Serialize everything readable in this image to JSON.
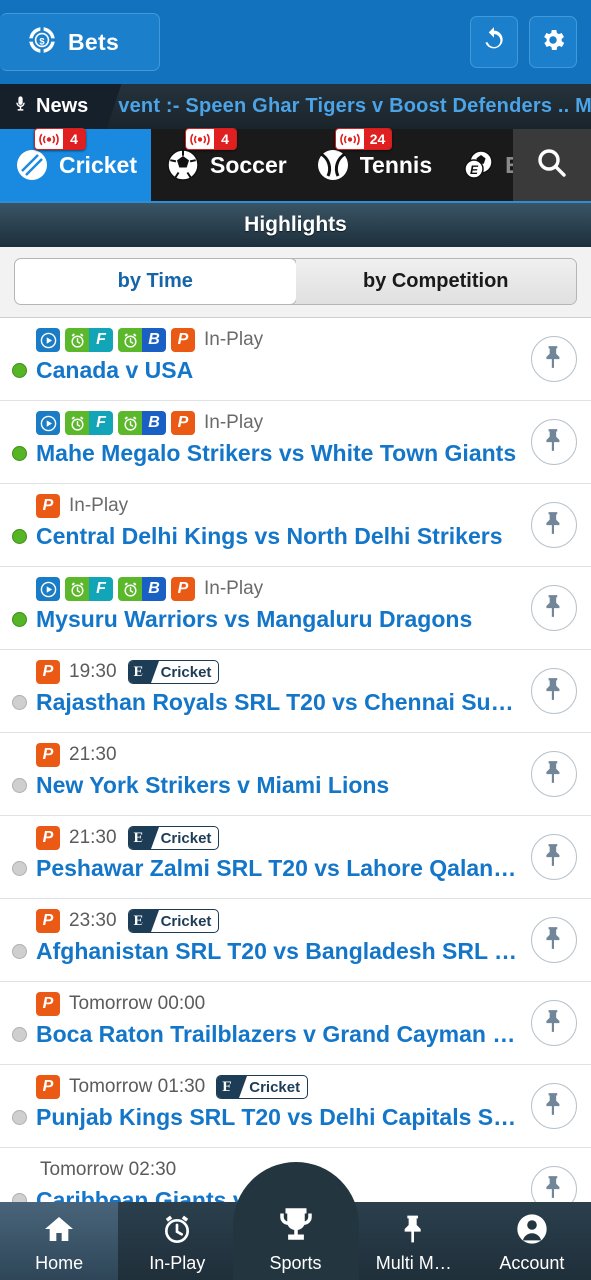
{
  "header": {
    "bets_label": "Bets",
    "bets_icon": "poker-chip-dollar-icon",
    "refresh_icon": "refresh-icon",
    "settings_icon": "gear-icon",
    "bg_color": "#1272bd"
  },
  "news": {
    "label": "News",
    "icon": "microphone-icon",
    "ticker_text": "vent :- Speen Ghar Tigers v Boost Defenders .. Ma",
    "text_color": "#4ba3e8"
  },
  "sport_tabs": [
    {
      "label": "Cricket",
      "icon": "cricket-ball-icon",
      "active": true,
      "live_count": "4",
      "dimmed": false
    },
    {
      "label": "Soccer",
      "icon": "soccer-ball-icon",
      "active": false,
      "live_count": "4",
      "dimmed": false
    },
    {
      "label": "Tennis",
      "icon": "tennis-ball-icon",
      "active": false,
      "live_count": "24",
      "dimmed": false
    },
    {
      "label": "E-S",
      "icon": "esports-ball-icon",
      "active": false,
      "live_count": "",
      "dimmed": true
    }
  ],
  "search": {
    "icon": "search-icon"
  },
  "section": {
    "title": "Highlights"
  },
  "segmented": {
    "options": [
      {
        "label": "by Time",
        "active": true
      },
      {
        "label": "by Competition",
        "active": false
      }
    ]
  },
  "matches": [
    {
      "icons": [
        "play",
        "alarm",
        "F",
        "alarm",
        "B",
        "P"
      ],
      "time": "In-Play",
      "competition": "",
      "name": "Canada v USA",
      "live": true
    },
    {
      "icons": [
        "play",
        "alarm",
        "F",
        "alarm",
        "B",
        "P"
      ],
      "time": "In-Play",
      "competition": "",
      "name": "Mahe Megalo Strikers vs White Town Giants",
      "live": true
    },
    {
      "icons": [
        "P"
      ],
      "time": "In-Play",
      "competition": "",
      "name": "Central Delhi Kings vs North Delhi Strikers",
      "live": true
    },
    {
      "icons": [
        "play",
        "alarm",
        "F",
        "alarm",
        "B",
        "P"
      ],
      "time": "In-Play",
      "competition": "",
      "name": "Mysuru Warriors vs Mangaluru Dragons",
      "live": true
    },
    {
      "icons": [
        "P"
      ],
      "time": "19:30",
      "competition": "Cricket",
      "name": "Rajasthan Royals SRL T20 vs Chennai Su…",
      "live": false
    },
    {
      "icons": [
        "P"
      ],
      "time": "21:30",
      "competition": "",
      "name": "New York Strikers v Miami Lions",
      "live": false
    },
    {
      "icons": [
        "P"
      ],
      "time": "21:30",
      "competition": "Cricket",
      "name": "Peshawar Zalmi SRL T20 vs Lahore Qalan…",
      "live": false
    },
    {
      "icons": [
        "P"
      ],
      "time": "23:30",
      "competition": "Cricket",
      "name": "Afghanistan SRL T20 vs Bangladesh SRL …",
      "live": false
    },
    {
      "icons": [
        "P"
      ],
      "time": "Tomorrow 00:00",
      "competition": "",
      "name": "Boca Raton Trailblazers v Grand Cayman …",
      "live": false
    },
    {
      "icons": [
        "P"
      ],
      "time": "Tomorrow 01:30",
      "competition": "Cricket",
      "name": "Punjab Kings SRL T20 vs Delhi Capitals S…",
      "live": false
    },
    {
      "icons": [],
      "time": "Tomorrow 02:30",
      "competition": "",
      "name": "Caribbean Giants v … ions",
      "live": false
    }
  ],
  "competition_badge": {
    "prefix": "E"
  },
  "bottom_nav": [
    {
      "label": "Home",
      "icon": "home-icon",
      "active": true,
      "center": false
    },
    {
      "label": "In-Play",
      "icon": "alarm-clock-icon",
      "active": false,
      "center": false
    },
    {
      "label": "Sports",
      "icon": "trophy-icon",
      "active": false,
      "center": true
    },
    {
      "label": "Multi M…",
      "icon": "pin-icon",
      "active": false,
      "center": false
    },
    {
      "label": "Account",
      "icon": "person-icon",
      "active": false,
      "center": false
    }
  ],
  "colors": {
    "header_blue": "#1272bd",
    "tab_active_blue": "#1a8ae0",
    "link_blue": "#1476c9",
    "live_green": "#55b524",
    "badge_red": "#e02020",
    "orange_p": "#ea5a15"
  }
}
